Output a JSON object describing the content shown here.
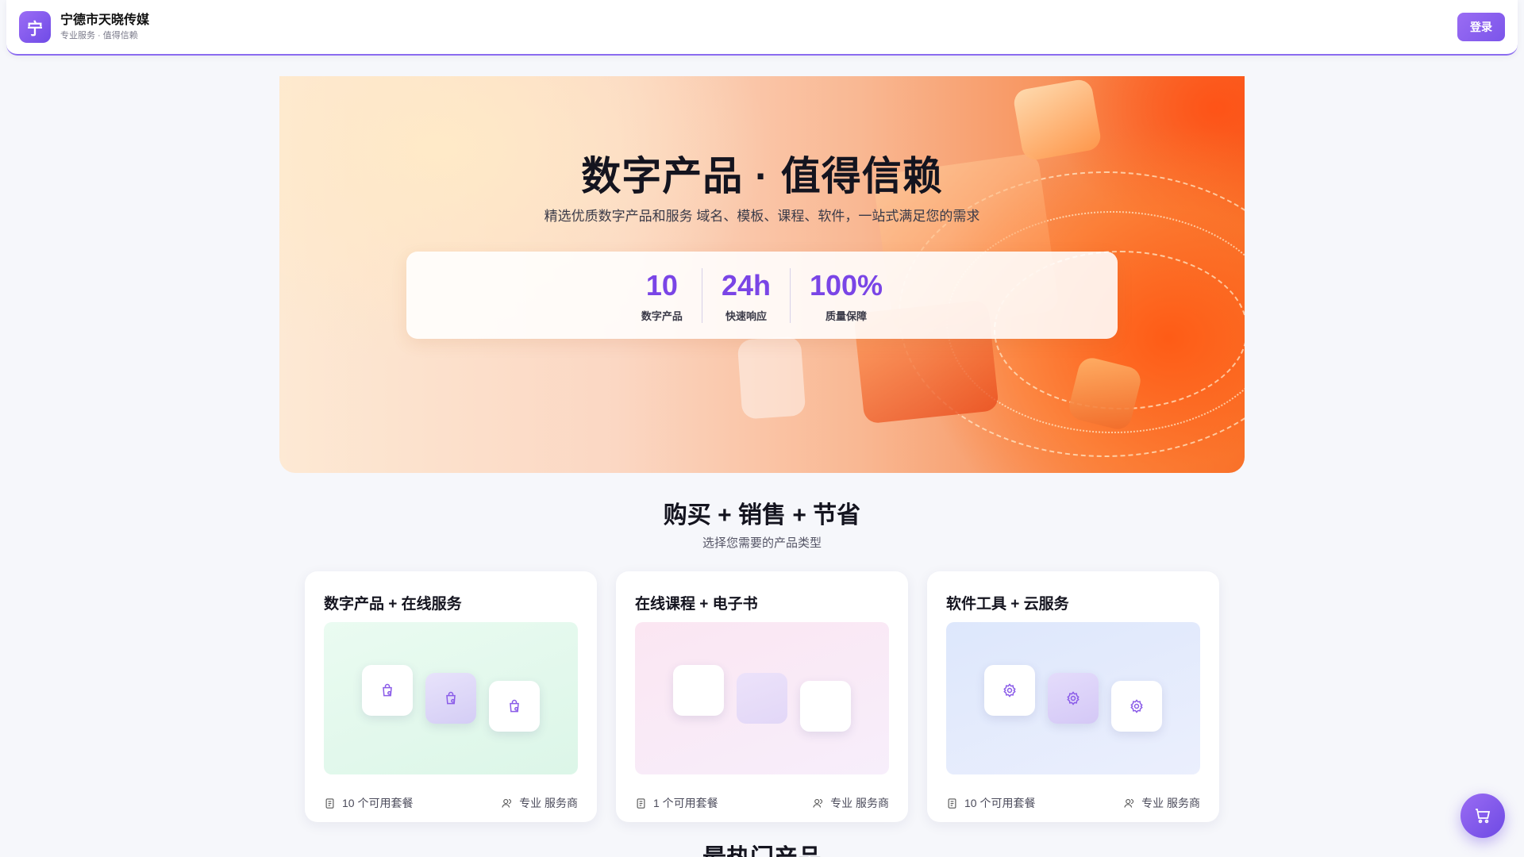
{
  "header": {
    "logo_char": "宁",
    "company_name": "宁德市天晓传媒",
    "tagline": "专业服务 · 值得信赖",
    "login_label": "登录"
  },
  "hero": {
    "title": "数字产品 · 值得信赖",
    "subtitle": "精选优质数字产品和服务 域名、模板、课程、软件，一站式满足您的需求",
    "stats": [
      {
        "value": "10",
        "label": "数字产品"
      },
      {
        "value": "24h",
        "label": "快速响应"
      },
      {
        "value": "100%",
        "label": "质量保障"
      }
    ]
  },
  "section": {
    "title": "购买 + 销售 + 节省",
    "subtitle": "选择您需要的产品类型"
  },
  "cards": [
    {
      "title": "数字产品 + 在线服务",
      "packages": "10 个可用套餐",
      "provider": "专业 服务商",
      "icon": "shopping-bag-icon",
      "bg_color": "#e3f8ec"
    },
    {
      "title": "在线课程 + 电子书",
      "packages": "1 个可用套餐",
      "provider": "专业 服务商",
      "icon": "none",
      "bg_color": "#fbe9f4"
    },
    {
      "title": "软件工具 + 云服务",
      "packages": "10 个可用套餐",
      "provider": "专业 服务商",
      "icon": "settings-gear-icon",
      "bg_color": "#e0e9fc"
    }
  ],
  "next_section": {
    "title": "最热门产品"
  },
  "colors": {
    "accent": "#7a45e6",
    "hero_orange": "#f36a2b"
  }
}
